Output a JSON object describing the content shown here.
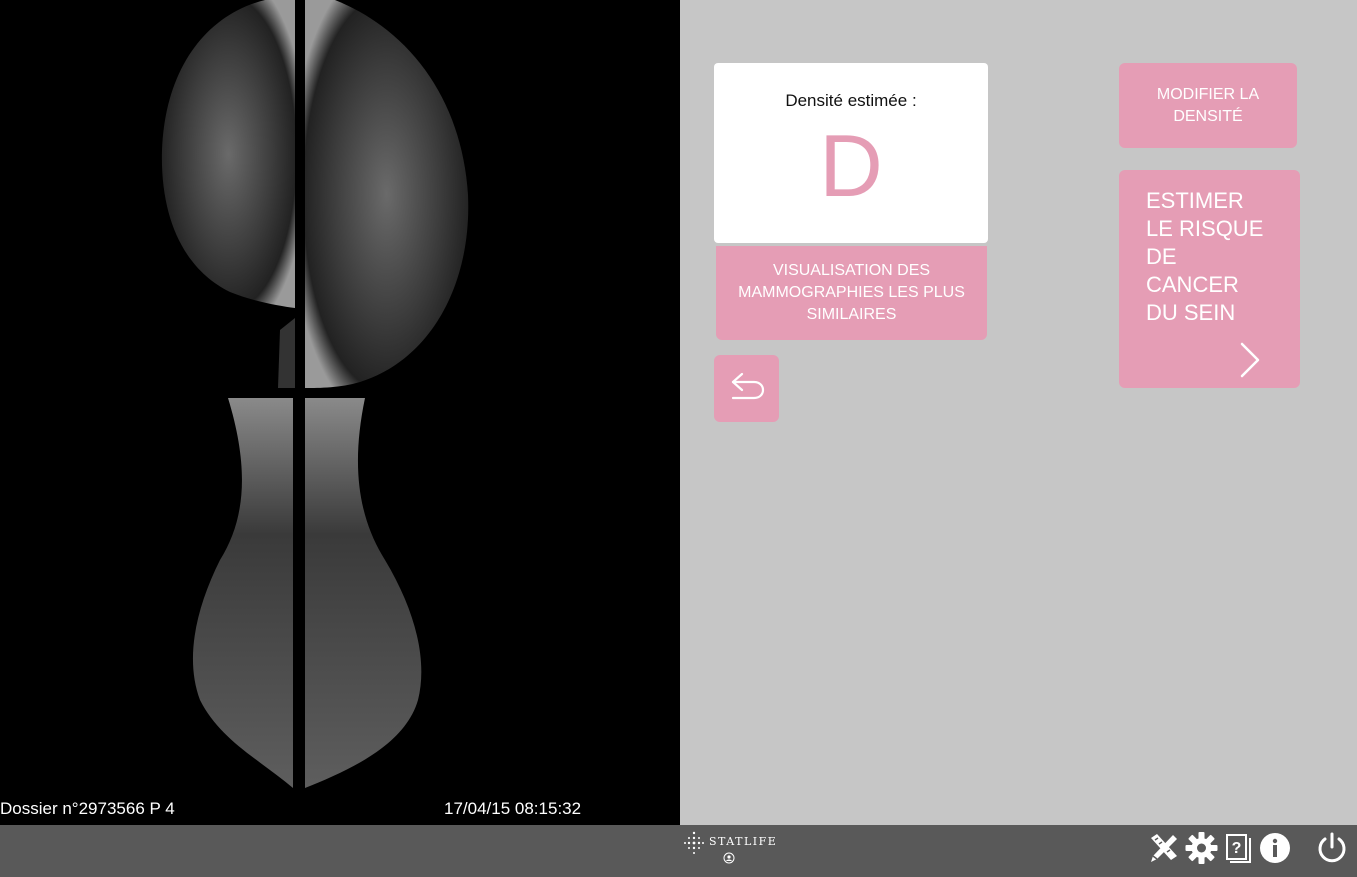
{
  "viewer": {
    "dossier_label": "Dossier n°2973566 P 4",
    "timestamp": "17/04/15 08:15:32"
  },
  "density_card": {
    "label": "Densité estimée :",
    "grade": "D"
  },
  "buttons": {
    "similar_mammograms": "VISUALISATION DES MAMMOGRAPHIES LES PLUS SIMILAIRES",
    "modify_density": "MODIFIER LA DENSITÉ",
    "estimate_risk": [
      "ESTIMER",
      "LE RISQUE",
      "DE",
      "CANCER",
      "DU SEIN"
    ]
  },
  "footer": {
    "brand": "STATLIFE"
  },
  "icons": {
    "back": "undo-arrow-icon",
    "next": "chevron-right-icon",
    "tools": "ruler-pencil-icon",
    "settings": "gear-icon",
    "help": "help-book-icon",
    "info": "info-icon",
    "power": "power-icon"
  },
  "colors": {
    "accent_pink": "#e59db5",
    "panel_gray": "#c6c6c6",
    "footer_gray": "#595959",
    "viewer_black": "#000000"
  }
}
